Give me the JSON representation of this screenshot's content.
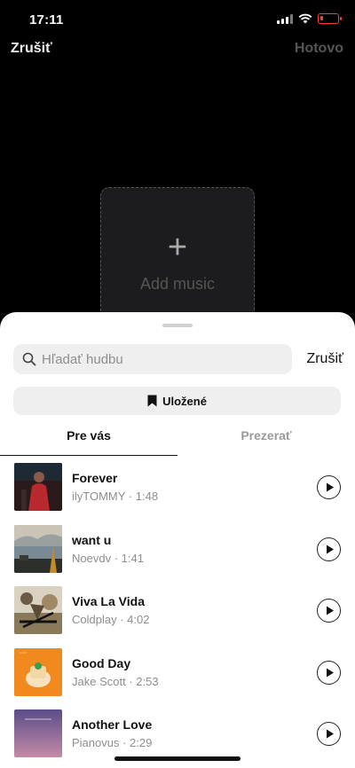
{
  "status": {
    "time": "17:11"
  },
  "nav": {
    "cancel": "Zrušiť",
    "done": "Hotovo"
  },
  "add_tile": {
    "plus": "+",
    "label": "Add music"
  },
  "search": {
    "placeholder": "Hľadať hudbu",
    "value": "",
    "cancel": "Zrušiť"
  },
  "saved": {
    "label": "Uložené"
  },
  "tabs": [
    {
      "label": "Pre vás",
      "active": true
    },
    {
      "label": "Prezerať",
      "active": false
    }
  ],
  "tracks": [
    {
      "title": "Forever",
      "meta": "ilyTOMMY · 1:48"
    },
    {
      "title": "want u",
      "meta": "Noevdv · 1:41"
    },
    {
      "title": "Viva La Vida",
      "meta": "Coldplay · 4:02"
    },
    {
      "title": "Good Day",
      "meta": "Jake Scott · 2:53"
    },
    {
      "title": "Another Love",
      "meta": "Pianovus · 2:29"
    }
  ],
  "colors": {
    "battery": "#ff3b30",
    "sheet": "#ffffff",
    "background": "#000000"
  }
}
